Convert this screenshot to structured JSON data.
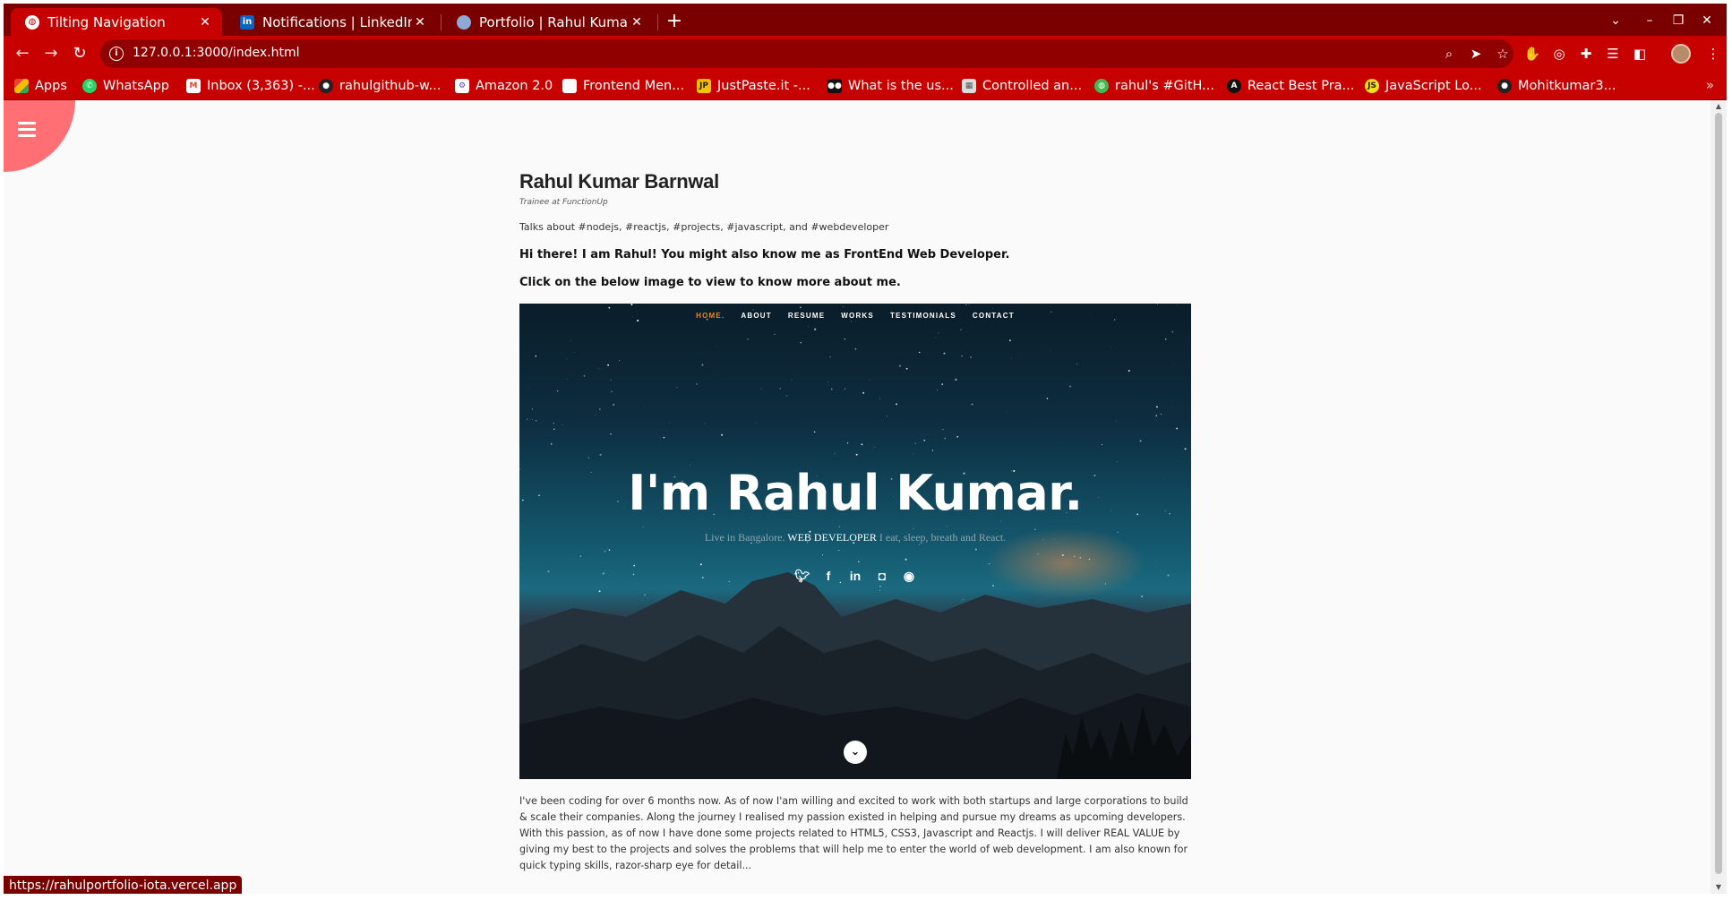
{
  "browser": {
    "tabs": [
      {
        "title": "Tilting Navigation",
        "active": true,
        "icon": "globe-icon"
      },
      {
        "title": "Notifications | LinkedIn",
        "active": false,
        "icon": "linkedin-icon"
      },
      {
        "title": "Portfolio | Rahul Kumar",
        "active": false,
        "icon": "avatar-icon"
      }
    ],
    "url": "127.0.0.1:3000/index.html",
    "bookmarks": [
      {
        "label": "Apps",
        "icon": "apps-grid-icon"
      },
      {
        "label": "WhatsApp",
        "icon": "whatsapp-icon"
      },
      {
        "label": "Inbox (3,363) -...",
        "icon": "gmail-icon"
      },
      {
        "label": "rahulgithub-w...",
        "icon": "github-icon"
      },
      {
        "label": "Amazon 2.0",
        "icon": "amazon-icon"
      },
      {
        "label": "Frontend Men...",
        "icon": "frontend-mentor-icon"
      },
      {
        "label": "JustPaste.it -...",
        "icon": "justpaste-icon"
      },
      {
        "label": "What is the us...",
        "icon": "medium-icon"
      },
      {
        "label": "Controlled an...",
        "icon": "page-icon"
      },
      {
        "label": "rahul's #GitH...",
        "icon": "github-globe-icon"
      },
      {
        "label": "React Best Pra...",
        "icon": "react-icon"
      },
      {
        "label": "JavaScript Lo...",
        "icon": "javascript-icon"
      },
      {
        "label": "Mohitkumar3...",
        "icon": "github-icon"
      }
    ],
    "status_url": "https://rahulportfolio-iota.vercel.app",
    "colors": {
      "frame": "#7a0000",
      "toolbar": "#c70000",
      "omnibox": "#900000"
    }
  },
  "page": {
    "name": "Rahul Kumar Barnwal",
    "role": "Trainee at FunctionUp",
    "tags": "Talks about #nodejs, #reactjs, #projects, #javascript, and #webdeveloper",
    "greeting": "Hi there! I am Rahul! You might also know me as FrontEnd Web Developer.",
    "click_prompt": "Click on the below image to view to know more about me.",
    "hero": {
      "nav": [
        "HOME.",
        "ABOUT",
        "RESUME",
        "WORKS",
        "TESTIMONIALS",
        "CONTACT"
      ],
      "title": "I'm Rahul Kumar.",
      "sub_before": "Live in Bangalore.",
      "sub_highlight": "WEB DEVELOPER",
      "sub_after": "I eat, sleep, breath and React.",
      "socials": [
        "twitter-icon",
        "facebook-icon",
        "linkedin-icon",
        "instagram-icon",
        "github-icon"
      ]
    },
    "bio": "I've been coding for over 6 months now. As of now I'am willing and excited to work with both startups and large corporations to build & scale their companies. Along the journey I realised my passion existed in helping and pursue my dreams as upcoming developers. With this passion, as of now I have done some projects related to HTML5, CSS3, Javascript and Reactjs. I will deliver REAL VALUE by giving my best to the projects and solves the problems that will help me to enter the world of web development. I am also known for quick typing skills, razor-sharp eye for detail...",
    "accent": "#ff6f73"
  }
}
